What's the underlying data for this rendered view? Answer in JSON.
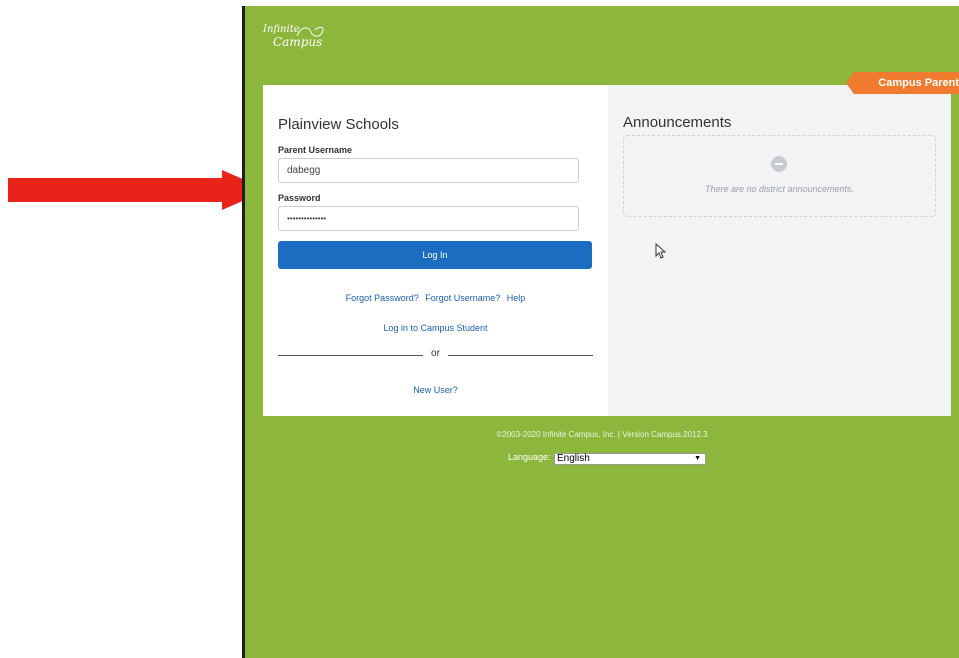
{
  "arrow_color": "#e8231a",
  "logo": {
    "line1": "Infinite",
    "line2": "Campus"
  },
  "portal_tag": "Campus Parent",
  "login": {
    "district": "Plainview Schools",
    "username_label": "Parent Username",
    "username_value": "dabegg",
    "password_label": "Password",
    "password_value": "••••••••••••••",
    "login_button": "Log In",
    "forgot_password": "Forgot Password?",
    "forgot_username": "Forgot Username?",
    "help": "Help",
    "student_link": "Log in to Campus Student",
    "or": "or",
    "new_user": "New User?"
  },
  "announcements": {
    "title": "Announcements",
    "empty_text": "There are no district announcements.",
    "empty_icon": "minus-circle-icon"
  },
  "footer": {
    "copyright": "©2003-2020 Infinite Campus, Inc. | Version Campus.2012.3",
    "language_label": "Language:",
    "language_value": "English"
  },
  "colors": {
    "background": "#8cb63c",
    "button": "#1a6dc0",
    "tag": "#f07b2e",
    "link": "#1a5fb4"
  }
}
